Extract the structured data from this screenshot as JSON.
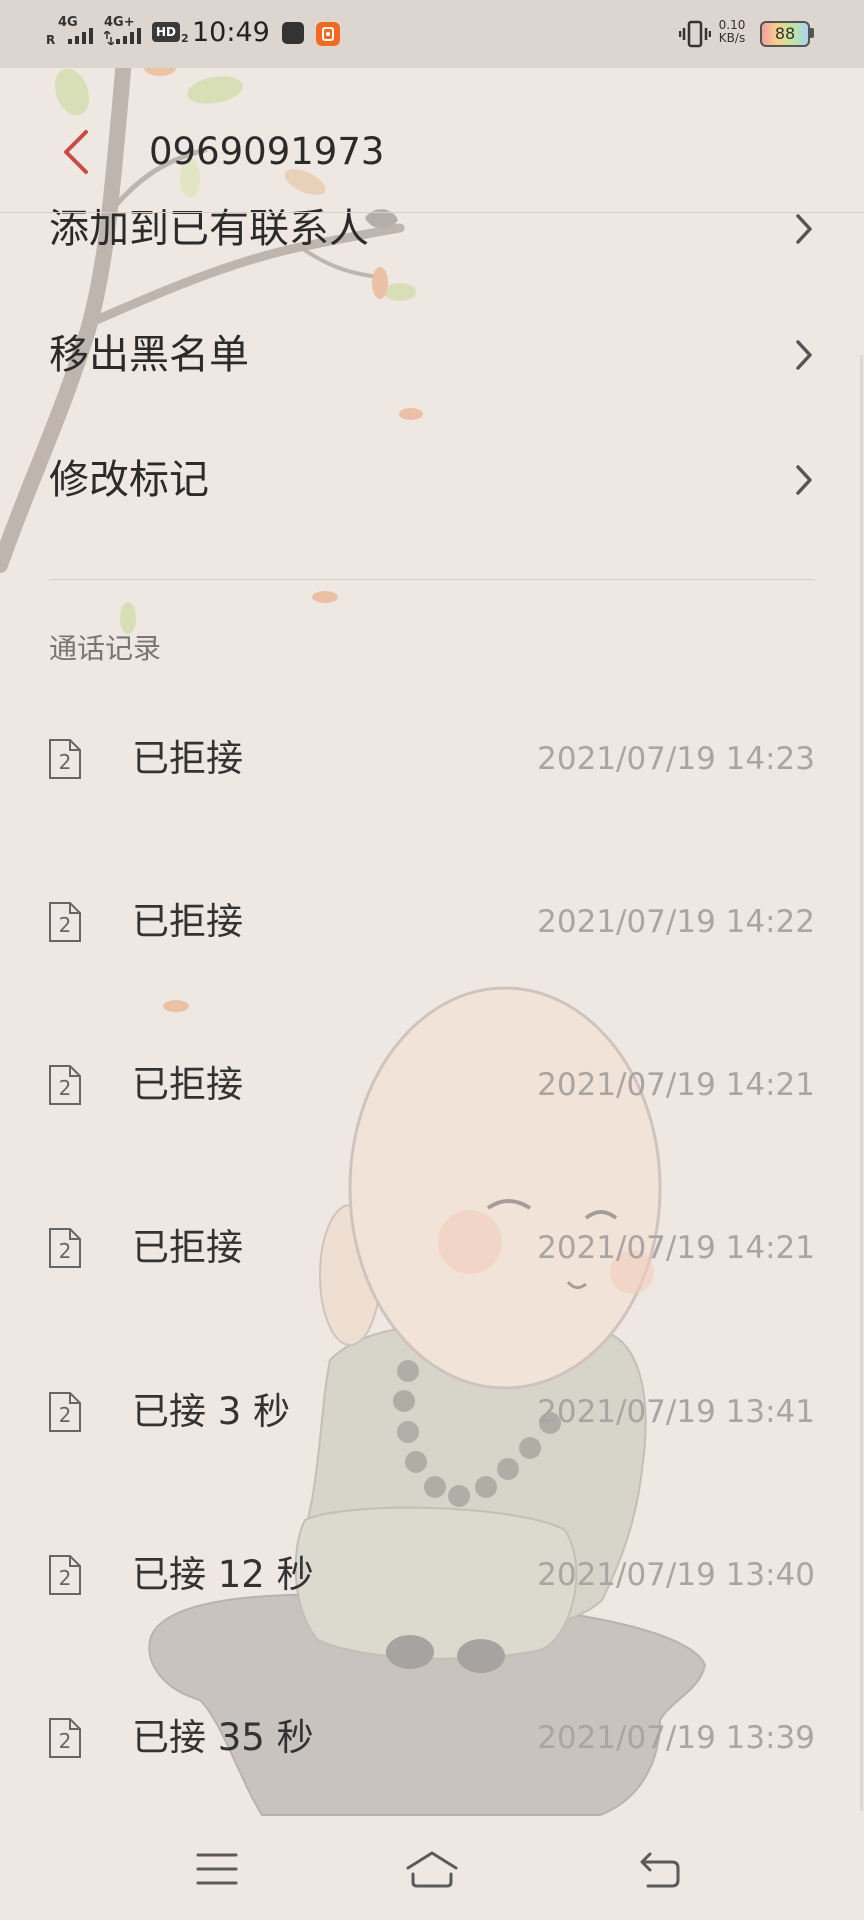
{
  "status_bar": {
    "roaming": "R",
    "sim1_network": "4G",
    "sim2_network": "4G+",
    "hd": "HD",
    "hd_sim": "2",
    "time": "10:49",
    "net_speed": "0.10",
    "net_speed_unit": "KB/s",
    "battery": "88"
  },
  "header": {
    "title": "0969091973",
    "back_icon": "back-arrow-icon"
  },
  "actions": [
    {
      "label": "添加到已有联系人",
      "icon": "chevron-right-icon"
    },
    {
      "label": "移出黑名单",
      "icon": "chevron-right-icon"
    },
    {
      "label": "修改标记",
      "icon": "chevron-right-icon"
    }
  ],
  "call_log": {
    "section_label": "通话记录",
    "entries": [
      {
        "sim": "2",
        "status": "已拒接",
        "time": "2021/07/19 14:23"
      },
      {
        "sim": "2",
        "status": "已拒接",
        "time": "2021/07/19 14:22"
      },
      {
        "sim": "2",
        "status": "已拒接",
        "time": "2021/07/19 14:21"
      },
      {
        "sim": "2",
        "status": "已拒接",
        "time": "2021/07/19 14:21"
      },
      {
        "sim": "2",
        "status": "已接 3 秒",
        "time": "2021/07/19 13:41"
      },
      {
        "sim": "2",
        "status": "已接 12 秒",
        "time": "2021/07/19 13:40"
      },
      {
        "sim": "2",
        "status": "已接 35 秒",
        "time": "2021/07/19 13:39"
      }
    ]
  },
  "nav_bar": {
    "icons": [
      "menu-icon",
      "home-icon",
      "back-icon"
    ]
  },
  "colors": {
    "background": "#efe7e2",
    "status_bar": "#ddd5d0",
    "accent": "#c94b45",
    "text_primary": "#2b2b2b",
    "text_secondary": "#a9a5a2",
    "section_label": "#7a7572"
  }
}
